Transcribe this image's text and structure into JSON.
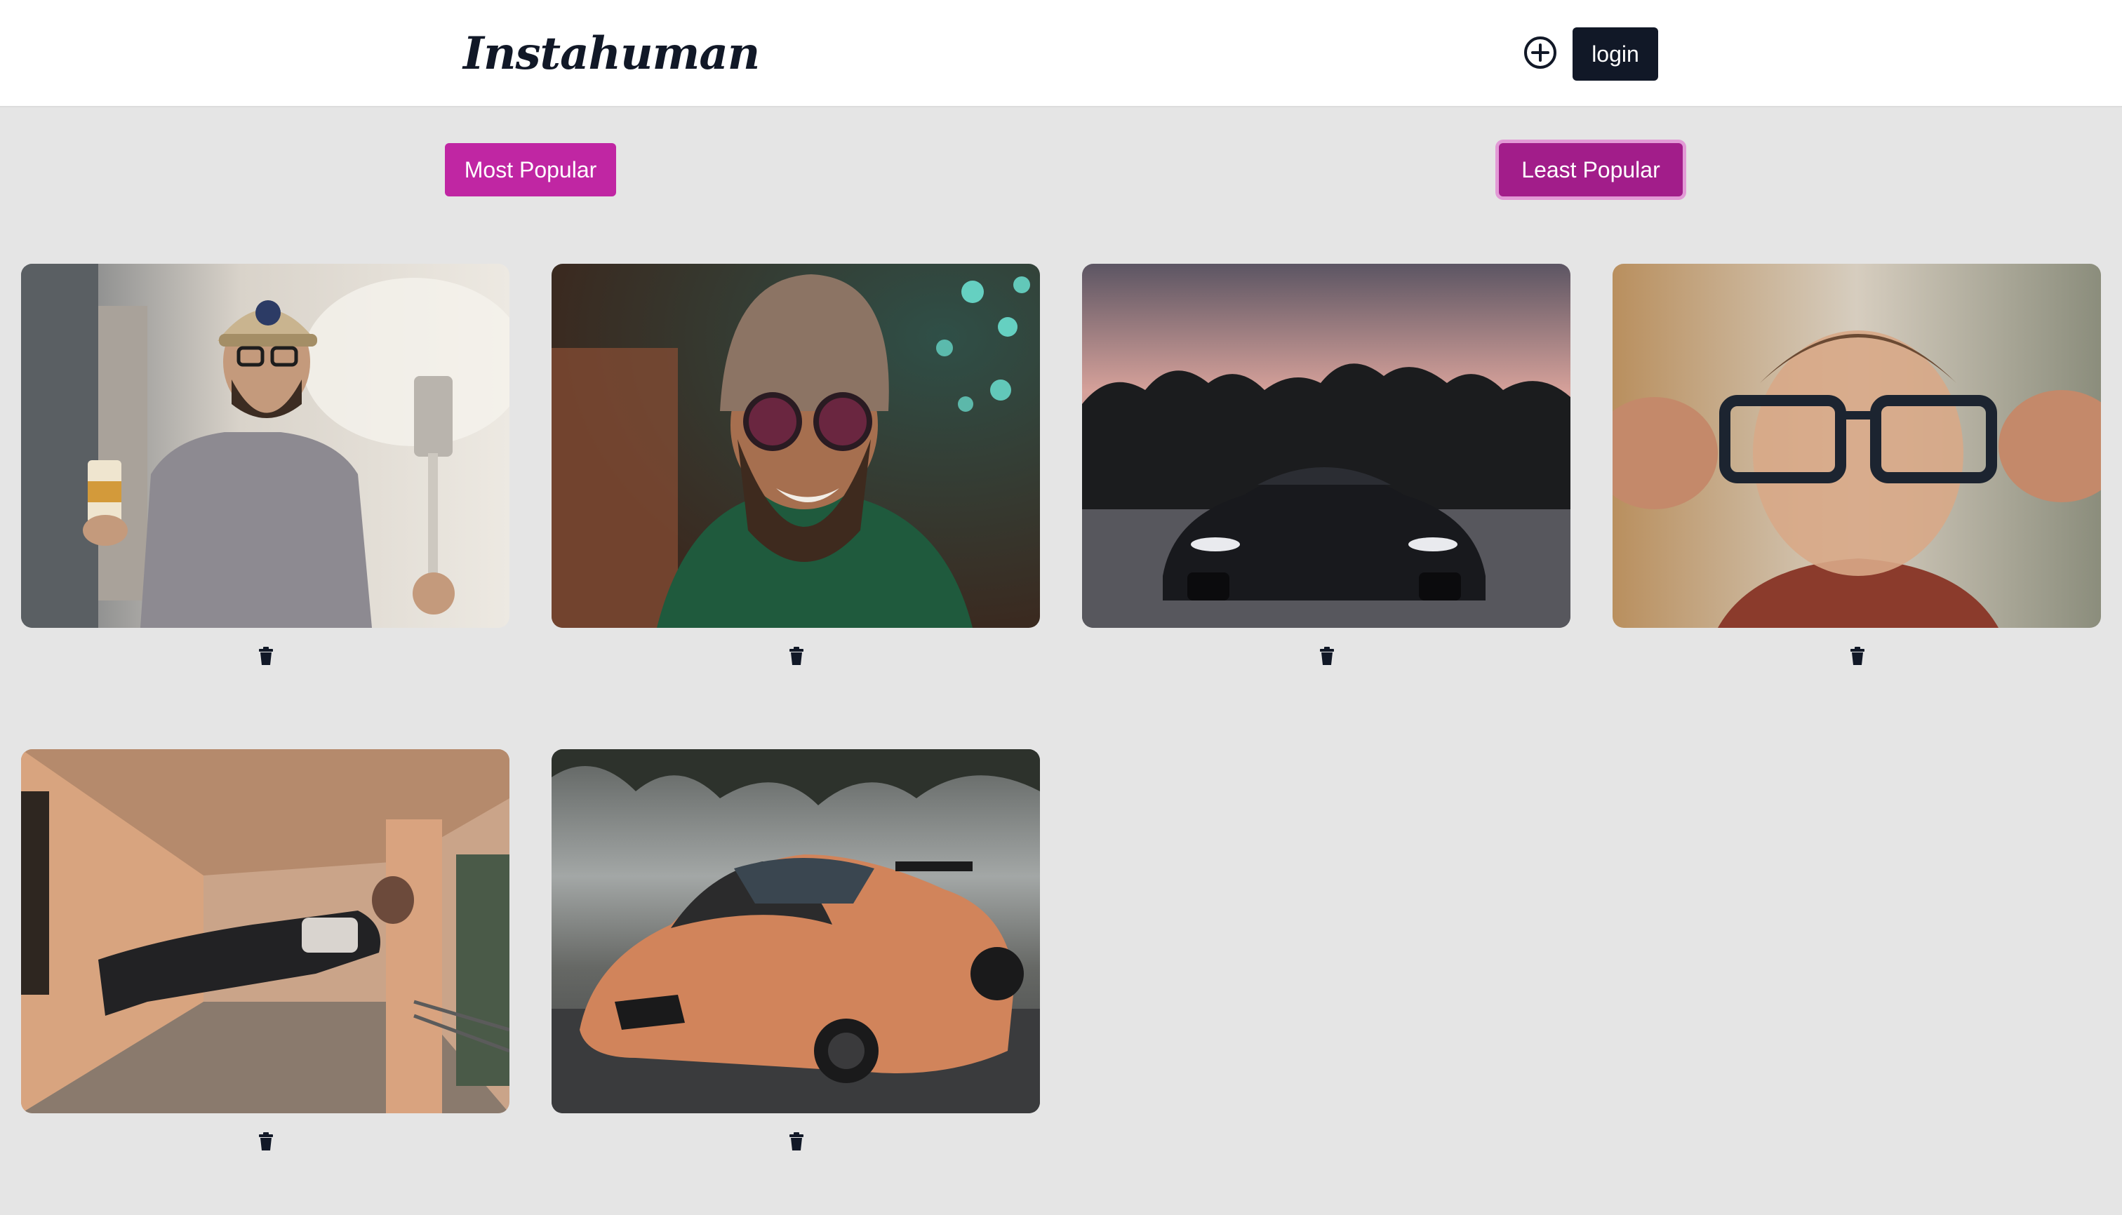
{
  "header": {
    "logo": "Instahuman",
    "add_icon": "plus-circle-icon",
    "login_label": "login"
  },
  "sort": {
    "most_popular_label": "Most Popular",
    "least_popular_label": "Least Popular"
  },
  "posts": [
    {
      "subject": "man-with-spatula-photo",
      "delete_icon": "trash-icon"
    },
    {
      "subject": "bearded-man-with-goggles-photo",
      "delete_icon": "trash-icon"
    },
    {
      "subject": "black-sedan-sunset-photo",
      "delete_icon": "trash-icon"
    },
    {
      "subject": "man-holding-glasses-photo",
      "delete_icon": "trash-icon"
    },
    {
      "subject": "man-floating-hallway-photo",
      "delete_icon": "trash-icon"
    },
    {
      "subject": "orange-sports-car-photo",
      "delete_icon": "trash-icon"
    }
  ],
  "colors": {
    "accent": "#c026a3",
    "accent_active": "#a21d8a",
    "dark": "#111827",
    "page_bg": "#e5e5e5"
  }
}
